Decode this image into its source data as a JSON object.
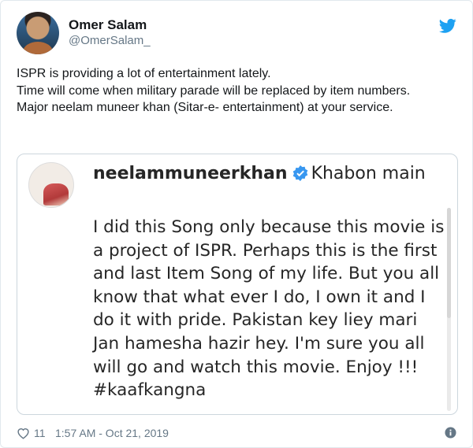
{
  "author": {
    "display_name": "Omer Salam",
    "handle": "@OmerSalam_"
  },
  "tweet": {
    "lines": [
      "ISPR is providing a lot of entertainment lately.",
      "Time will come when military parade will be replaced by item numbers.",
      "Major neelam muneer khan (Sitar-e- entertainment) at your service."
    ]
  },
  "quoted": {
    "username": "neelammuneerkhan",
    "location": "Khabon main",
    "caption": "I did this Song only because this movie is a project of ISPR. Perhaps this is the first and last Item Song of my life. But you all know that what ever I do, I own it and I do it with pride. Pakistan key liey mari Jan hamesha hazir hey. I'm sure you all will go and watch this movie. Enjoy !!! #kaafkangna"
  },
  "footer": {
    "likes": "11",
    "timestamp": "1:57 AM - Oct 21, 2019"
  },
  "colors": {
    "twitter_blue": "#1da1f2",
    "verified_blue": "#3897f0",
    "muted": "#657786"
  },
  "icons": [
    "twitter-bird-icon",
    "verified-badge-icon",
    "heart-icon",
    "info-icon"
  ]
}
